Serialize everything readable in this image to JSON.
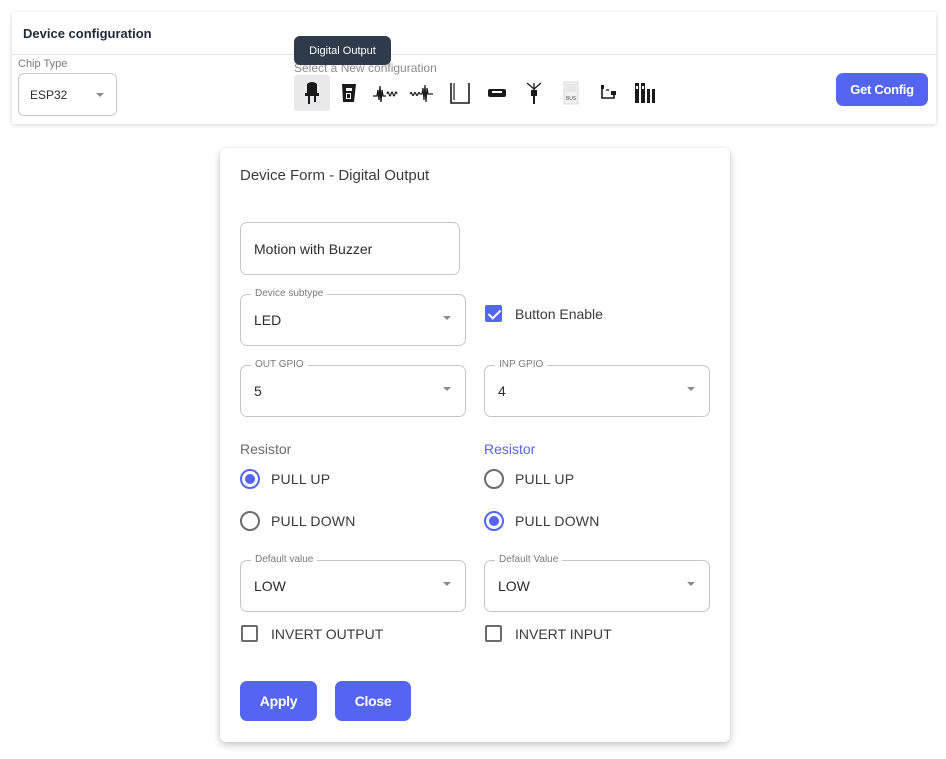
{
  "header": {
    "title": "Device configuration",
    "chip_type_label": "Chip Type",
    "chip_type_value": "ESP32",
    "config_label": "Select a New configuration",
    "tooltip": "Digital Output",
    "get_config_label": "Get Config",
    "config_icons": [
      {
        "name": "led-digital-output-icon",
        "active": true
      },
      {
        "name": "relay-module-icon",
        "active": false
      },
      {
        "name": "analog-waveform-icon",
        "active": false
      },
      {
        "name": "pwm-waveform-icon",
        "active": false
      },
      {
        "name": "bracket-sensor-icon",
        "active": false
      },
      {
        "name": "display-module-icon",
        "active": false
      },
      {
        "name": "antenna-icon",
        "active": false
      },
      {
        "name": "bus-module-icon",
        "active": false
      },
      {
        "name": "i2c-connector-icon",
        "active": false
      },
      {
        "name": "multi-pin-connector-icon",
        "active": false
      }
    ]
  },
  "form": {
    "title": "Device Form - Digital Output",
    "device_name": "Motion with Buzzer",
    "device_subtype_label": "Device subtype",
    "device_subtype_value": "LED",
    "button_enable_label": "Button Enable",
    "button_enable_checked": true,
    "out_gpio_label": "OUT GPIO",
    "out_gpio_value": "5",
    "inp_gpio_label": "INP GPIO",
    "inp_gpio_value": "4",
    "left_resistor": {
      "label": "Resistor",
      "options": [
        "PULL UP",
        "PULL DOWN"
      ],
      "selected": "PULL UP"
    },
    "right_resistor": {
      "label": "Resistor",
      "options": [
        "PULL UP",
        "PULL DOWN"
      ],
      "selected": "PULL DOWN"
    },
    "default_value_left_label": "Default value",
    "default_value_left": "LOW",
    "default_value_right_label": "Default Value",
    "default_value_right": "LOW",
    "invert_output_label": "INVERT OUTPUT",
    "invert_input_label": "INVERT INPUT",
    "apply_label": "Apply",
    "close_label": "Close"
  },
  "colors": {
    "accent": "#5465f2",
    "tooltip_bg": "#2f3a4a",
    "border": "#c6c6c6"
  }
}
